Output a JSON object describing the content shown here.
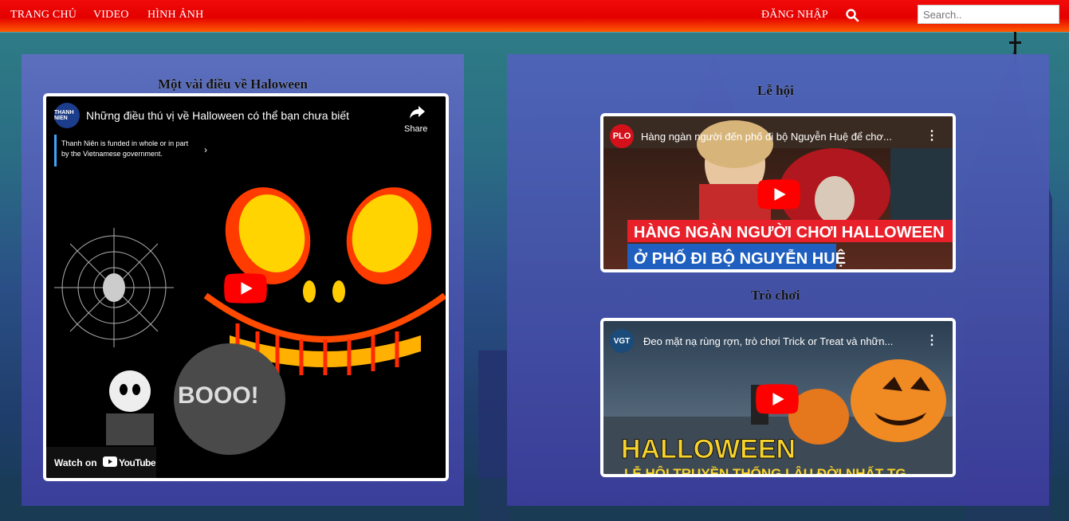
{
  "nav": {
    "home": "TRANG CHỦ",
    "video": "VIDEO",
    "images": "HÌNH ẢNH",
    "login": "ĐĂNG NHẬP",
    "search_placeholder": "Search.."
  },
  "left": {
    "title": "Một vài điều về Haloween",
    "video": {
      "channel": "THANH NIEN",
      "title": "Những điều thú vị về Halloween có thể bạn chưa biết",
      "share": "Share",
      "funding_notice": "Thanh Niên is funded in whole or in part by the Vietnamese government.",
      "watch_on": "Watch on",
      "youtube": "YouTube",
      "booo_text": "BOOO!"
    }
  },
  "right": {
    "festival_title": "Lễ hội",
    "games_title": "Trò chơi",
    "video1": {
      "channel": "PLO",
      "title": "Hàng ngàn người đến phố đi bộ Nguyễn Huệ để chơ...",
      "caption_top": "HÀNG NGÀN NGƯỜI CHƠI HALLOWEEN",
      "caption_bottom": "Ở PHỐ ĐI BỘ NGUYỄN HUỆ"
    },
    "video2": {
      "channel": "VGT",
      "title": "Đeo mặt nạ rùng rợn, trò chơi Trick or Treat và nhữn...",
      "caption_top": "HALLOWEEN",
      "caption_bottom": "LỄ HỘI TRUYỀN THỐNG LÂU ĐỜI NHẤT TG"
    }
  },
  "colors": {
    "nav_red": "#e40000",
    "nav_orange": "#ff5a00",
    "play_red": "#ff0000",
    "caption_red": "#e8202a",
    "caption_blue": "#1f5fbf",
    "halloween_yellow": "#f7d22c"
  }
}
